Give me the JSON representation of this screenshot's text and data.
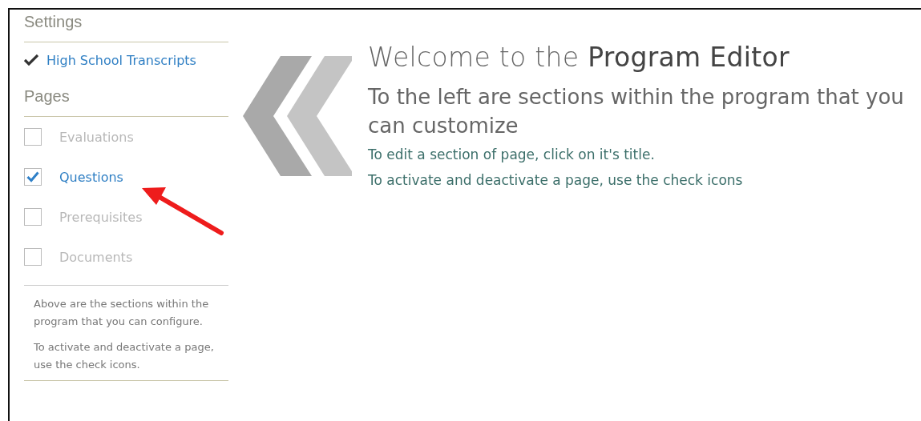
{
  "sidebar": {
    "settings_heading": "Settings",
    "settings_items": [
      {
        "label": "High School Transcripts",
        "checked": true
      }
    ],
    "pages_heading": "Pages",
    "pages": [
      {
        "label": "Evaluations",
        "checked": false
      },
      {
        "label": "Questions",
        "checked": true
      },
      {
        "label": "Prerequisites",
        "checked": false
      },
      {
        "label": "Documents",
        "checked": false
      }
    ],
    "notes": [
      "Above are the sections within the program that you can configure.",
      "To activate and deactivate a page, use the check icons."
    ]
  },
  "main": {
    "title": "Welcome to the **Program Editor**",
    "subtitle": "To the left are sections within the program that you can customize",
    "hints": [
      "To edit a section of page, click on it's title.",
      "To activate and deactivate a page, use the check icons"
    ]
  },
  "annotation": {
    "kind": "arrow",
    "color": "#ee1c1c"
  }
}
